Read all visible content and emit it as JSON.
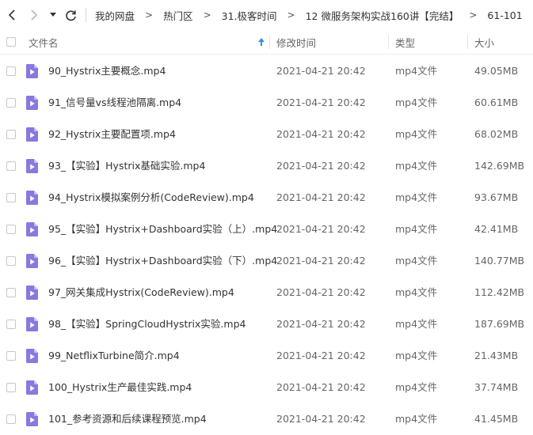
{
  "toolbar": {
    "back_icon": "chevron-left-icon",
    "forward_icon": "chevron-right-icon",
    "history_icon": "caret-down-icon",
    "refresh_icon": "refresh-icon"
  },
  "breadcrumb": [
    "我的网盘",
    "热门区",
    "31.极客时间",
    "12 微服务架构实战160讲【完结】",
    "61-101"
  ],
  "columns": {
    "name": "文件名",
    "modified": "修改时间",
    "type": "类型",
    "size": "大小",
    "sort_icon": "sort-up-arrow-icon"
  },
  "files": [
    {
      "name": "90_Hystrix主要概念.mp4",
      "modified": "2021-04-21 20:42",
      "type": "mp4文件",
      "size": "49.05MB"
    },
    {
      "name": "91_信号量vs线程池隔离.mp4",
      "modified": "2021-04-21 20:42",
      "type": "mp4文件",
      "size": "60.61MB"
    },
    {
      "name": "92_Hystrix主要配置项.mp4",
      "modified": "2021-04-21 20:42",
      "type": "mp4文件",
      "size": "68.02MB"
    },
    {
      "name": "93_【实验】Hystrix基础实验.mp4",
      "modified": "2021-04-21 20:42",
      "type": "mp4文件",
      "size": "142.69MB"
    },
    {
      "name": "94_Hystrix模拟案例分析(CodeReview).mp4",
      "modified": "2021-04-21 20:42",
      "type": "mp4文件",
      "size": "93.67MB"
    },
    {
      "name": "95_【实验】Hystrix+Dashboard实验（上）.mp4",
      "modified": "2021-04-21 20:42",
      "type": "mp4文件",
      "size": "42.41MB"
    },
    {
      "name": "96_【实验】Hystrix+Dashboard实验（下）.mp4",
      "modified": "2021-04-21 20:42",
      "type": "mp4文件",
      "size": "140.77MB"
    },
    {
      "name": "97_网关集成Hystrix(CodeReview).mp4",
      "modified": "2021-04-21 20:42",
      "type": "mp4文件",
      "size": "112.42MB"
    },
    {
      "name": "98_【实验】SpringCloudHystrix实验.mp4",
      "modified": "2021-04-21 20:42",
      "type": "mp4文件",
      "size": "187.69MB"
    },
    {
      "name": "99_NetflixTurbine简介.mp4",
      "modified": "2021-04-21 20:42",
      "type": "mp4文件",
      "size": "21.43MB"
    },
    {
      "name": "100_Hystrix生产最佳实践.mp4",
      "modified": "2021-04-21 20:42",
      "type": "mp4文件",
      "size": "37.74MB"
    },
    {
      "name": "101_参考资源和后续课程预览.mp4",
      "modified": "2021-04-21 20:42",
      "type": "mp4文件",
      "size": "41.45MB"
    }
  ],
  "colors": {
    "video_icon": "#8a78e0",
    "video_icon_fold": "#c6bdf3",
    "sort_arrow": "#3b8be6"
  }
}
